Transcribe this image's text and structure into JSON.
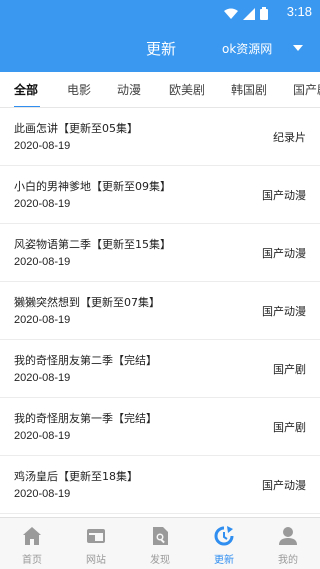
{
  "status": {
    "time": "3:18"
  },
  "header": {
    "title": "更新",
    "source": "ok资源网"
  },
  "tabs": [
    {
      "label": "全部"
    },
    {
      "label": "电影"
    },
    {
      "label": "动漫"
    },
    {
      "label": "欧美剧"
    },
    {
      "label": "韩国剧"
    },
    {
      "label": "国产剧"
    }
  ],
  "items": [
    {
      "name": "此画怎讲【更新至05集】",
      "date": "2020-08-19",
      "category": "纪录片"
    },
    {
      "name": "小白的男神爹地【更新至09集】",
      "date": "2020-08-19",
      "category": "国产动漫"
    },
    {
      "name": "风姿物语第二季【更新至15集】",
      "date": "2020-08-19",
      "category": "国产动漫"
    },
    {
      "name": "獭獭突然想到【更新至07集】",
      "date": "2020-08-19",
      "category": "国产动漫"
    },
    {
      "name": "我的奇怪朋友第二季【完结】",
      "date": "2020-08-19",
      "category": "国产剧"
    },
    {
      "name": "我的奇怪朋友第一季【完结】",
      "date": "2020-08-19",
      "category": "国产剧"
    },
    {
      "name": "鸡汤皇后【更新至18集】",
      "date": "2020-08-19",
      "category": "国产动漫"
    }
  ],
  "nav": [
    {
      "label": "首页",
      "icon": "home-icon"
    },
    {
      "label": "网站",
      "icon": "website-icon"
    },
    {
      "label": "发现",
      "icon": "discover-icon"
    },
    {
      "label": "更新",
      "icon": "update-icon"
    },
    {
      "label": "我的",
      "icon": "profile-icon"
    }
  ],
  "colors": {
    "primary": "#3a98f0",
    "accent": "#2f8ef0",
    "nav_inactive": "#9a9a9a"
  }
}
